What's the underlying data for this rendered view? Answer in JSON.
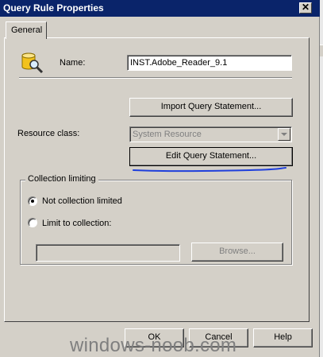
{
  "window": {
    "title": "Query Rule Properties",
    "close_glyph": "✕"
  },
  "tabs": [
    {
      "label": "General"
    }
  ],
  "name": {
    "label": "Name:",
    "value": "INST.Adobe_Reader_9.1",
    "icon": "query-rule-icon"
  },
  "buttons": {
    "import_query": "Import Query Statement...",
    "edit_query": "Edit Query Statement...",
    "browse": "Browse...",
    "ok": "OK",
    "cancel": "Cancel",
    "help": "Help"
  },
  "resource_class": {
    "label": "Resource class:",
    "selected": "System Resource"
  },
  "collection_limiting": {
    "legend": "Collection limiting",
    "options": [
      {
        "label": "Not collection limited",
        "checked": true
      },
      {
        "label": "Limit to collection:",
        "checked": false
      }
    ],
    "collection_value": ""
  },
  "annotation": {
    "color": "#1f3fdc"
  },
  "watermark": "windows-noob.com"
}
